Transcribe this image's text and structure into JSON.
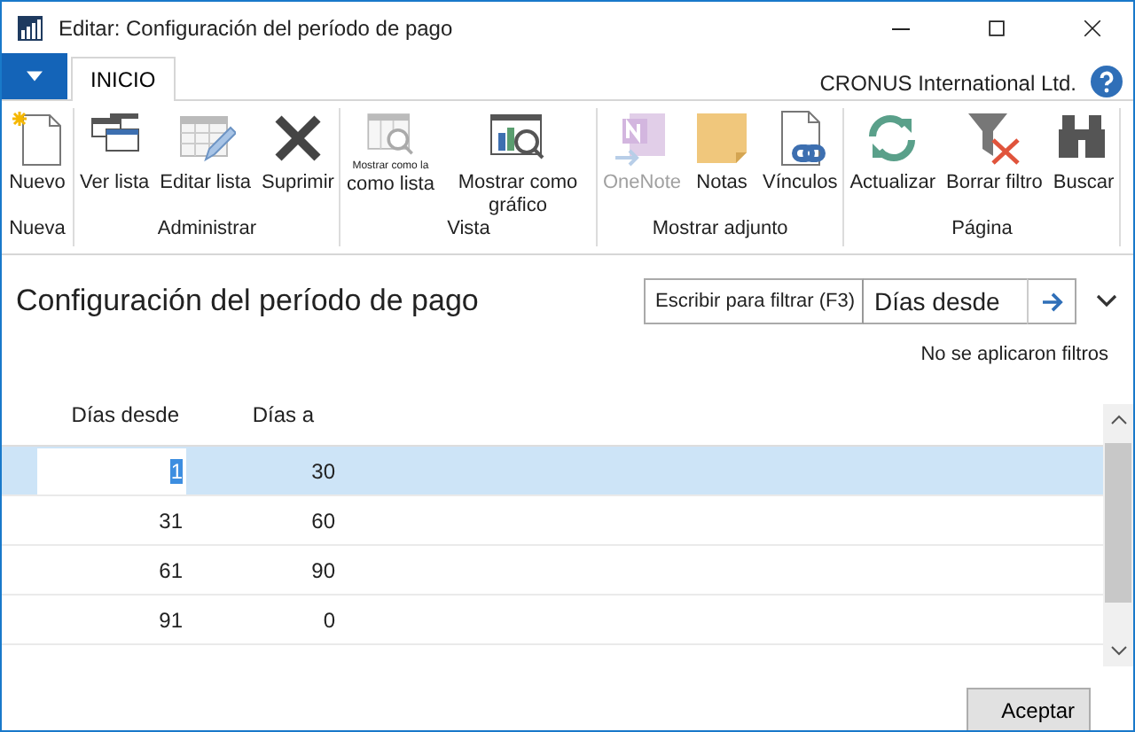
{
  "window": {
    "title": "Editar: Configuración del período de pago"
  },
  "tabs": [
    {
      "label": "INICIO",
      "selected": true
    }
  ],
  "company": "CRONUS International Ltd.",
  "ribbon": [
    {
      "label": "Nueva",
      "buttons": [
        {
          "label": "Nuevo",
          "disabled": false
        }
      ]
    },
    {
      "label": "Administrar",
      "buttons": [
        {
          "label": "Ver lista",
          "disabled": false
        },
        {
          "label": "Editar lista",
          "disabled": false
        },
        {
          "label": "Suprimir",
          "disabled": false
        }
      ]
    },
    {
      "label": "Vista",
      "buttons": [
        {
          "label": "como lista",
          "caption_top": "Mostrar como la",
          "disabled": false
        },
        {
          "label": "Mostrar como gráfico",
          "disabled": false
        }
      ]
    },
    {
      "label": "Mostrar adjunto",
      "buttons": [
        {
          "label": "OneNote",
          "disabled": true
        },
        {
          "label": "Notas",
          "disabled": false
        },
        {
          "label": "Vínculos",
          "disabled": false
        }
      ]
    },
    {
      "label": "Página",
      "buttons": [
        {
          "label": "Actualizar",
          "disabled": false
        },
        {
          "label": "Borrar filtro",
          "disabled": false
        },
        {
          "label": "Buscar",
          "disabled": false
        }
      ]
    }
  ],
  "page": {
    "title": "Configuración del período de pago",
    "filter": {
      "label": "Escribir para filtrar (F3)",
      "value": "Días desde"
    },
    "filter_status": "No se aplicaron filtros"
  },
  "table": {
    "columns": [
      "Días desde",
      "Días a"
    ],
    "rows": [
      {
        "cells": [
          "1",
          "30"
        ],
        "selected": true
      },
      {
        "cells": [
          "31",
          "60"
        ],
        "selected": false
      },
      {
        "cells": [
          "61",
          "90"
        ],
        "selected": false
      },
      {
        "cells": [
          "91",
          "0"
        ],
        "selected": false
      }
    ]
  },
  "buttons": [
    "Aceptar"
  ]
}
